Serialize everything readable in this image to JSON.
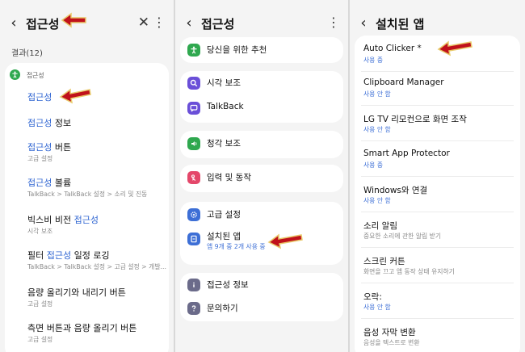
{
  "panel1": {
    "title": "접근성",
    "results_label": "결과(12)",
    "section_label": "접근성",
    "items": [
      {
        "pre": "",
        "hl": "접근성",
        "post": "",
        "sub": ""
      },
      {
        "pre": "",
        "hl": "접근성",
        "post": " 정보",
        "sub": ""
      },
      {
        "pre": "",
        "hl": "접근성",
        "post": " 버튼",
        "sub": "고급 설정"
      },
      {
        "pre": "",
        "hl": "접근성",
        "post": " 볼륨",
        "sub": "TalkBack > TalkBack 설정 > 소리 및 진동"
      },
      {
        "pre": "빅스비 비전 ",
        "hl": "접근성",
        "post": "",
        "sub": "시각 보조"
      },
      {
        "pre": "필터 ",
        "hl": "접근성",
        "post": " 일정 로깅",
        "sub": "TalkBack > TalkBack 설정 > 고급 설정 > 개발..."
      },
      {
        "pre": "음량 올리기와 내리기 버튼",
        "hl": "",
        "post": "",
        "sub": "고급 설정"
      },
      {
        "pre": "측면 버튼과 음량 올리기 버튼",
        "hl": "",
        "post": "",
        "sub": "고급 설정"
      }
    ]
  },
  "panel2": {
    "title": "접근성",
    "groups": [
      [
        {
          "label": "당신을 위한 추천",
          "sub": "",
          "icon": "accessibility-person-icon",
          "color": "#2fa84f"
        }
      ],
      [
        {
          "label": "시각 보조",
          "sub": "",
          "icon": "magnifier-icon",
          "color": "#6a4fd8"
        },
        {
          "label": "TalkBack",
          "sub": "",
          "icon": "talkback-icon",
          "color": "#6a4fd8"
        }
      ],
      [
        {
          "label": "청각 보조",
          "sub": "",
          "icon": "hearing-icon",
          "color": "#2fa84f"
        }
      ],
      [
        {
          "label": "입력 및 동작",
          "sub": "",
          "icon": "touch-icon",
          "color": "#e4476a"
        }
      ],
      [
        {
          "label": "고급 설정",
          "sub": "",
          "icon": "advanced-gear-icon",
          "color": "#3d6fd6"
        },
        {
          "label": "설치된 앱",
          "sub": "앱 9개 중 2개 사용 중",
          "icon": "installed-apps-icon",
          "color": "#3d6fd6"
        }
      ],
      [
        {
          "label": "접근성 정보",
          "sub": "",
          "icon": "info-icon",
          "color": "#6b6b8a"
        },
        {
          "label": "문의하기",
          "sub": "",
          "icon": "help-icon",
          "color": "#6b6b8a"
        }
      ]
    ]
  },
  "panel3": {
    "title": "설치된 앱",
    "items": [
      {
        "label": "Auto Clicker *",
        "status": "사용 중",
        "desc": ""
      },
      {
        "label": "Clipboard Manager",
        "status": "사용 안 함",
        "desc": ""
      },
      {
        "label": "LG TV 리모컨으로 화면 조작",
        "status": "사용 안 함",
        "desc": ""
      },
      {
        "label": "Smart App Protector",
        "status": "사용 중",
        "desc": ""
      },
      {
        "label": "Windows와 연결",
        "status": "사용 안 함",
        "desc": ""
      },
      {
        "label": "소리 알림",
        "status": "",
        "desc": "중요한 소리에 관한 알림 받기"
      },
      {
        "label": "스크린 커튼",
        "status": "",
        "desc": "화면을 끄고 앱 동작 상태 유지하기"
      },
      {
        "label": "오락:",
        "status": "사용 안 함",
        "desc": ""
      },
      {
        "label": "음성 자막 변환",
        "status": "",
        "desc": "음성을 텍스트로 변환"
      }
    ]
  },
  "colors": {
    "highlight": "#2f65d2",
    "arrow": "#c0111b",
    "arrow_outline": "#e8c96a"
  }
}
